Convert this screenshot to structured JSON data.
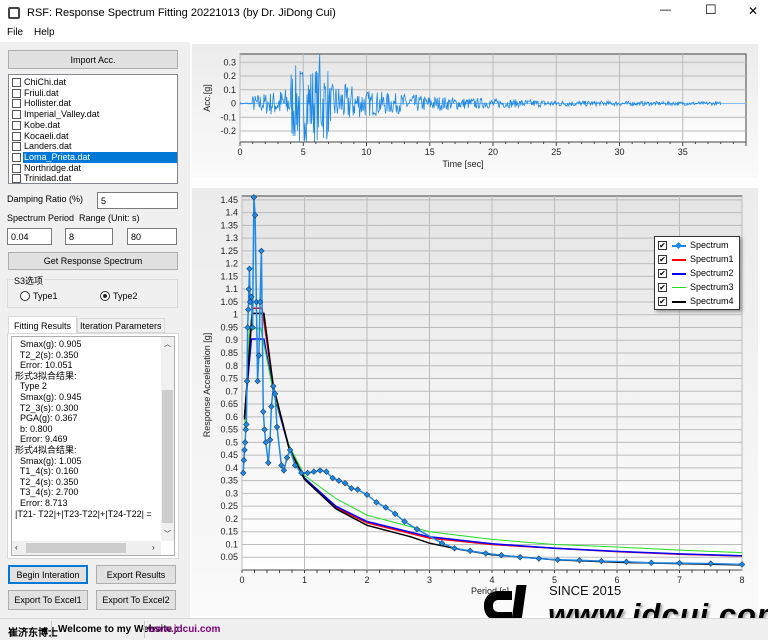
{
  "window": {
    "title": "RSF: Response Spectrum Fitting 20221013 (by Dr. JiDong Cui)",
    "minimize": "—",
    "maximize": "☐",
    "close": "✕"
  },
  "menu": [
    "File",
    "Help"
  ],
  "left": {
    "import_button": "Import Acc.",
    "files": [
      {
        "name": "ChiChi.dat",
        "selected": false
      },
      {
        "name": "Friuli.dat",
        "selected": false
      },
      {
        "name": "Hollister.dat",
        "selected": false
      },
      {
        "name": "Imperial_Valley.dat",
        "selected": false
      },
      {
        "name": "Kobe.dat",
        "selected": false
      },
      {
        "name": "Kocaeli.dat",
        "selected": false
      },
      {
        "name": "Landers.dat",
        "selected": false
      },
      {
        "name": "Loma_Prieta.dat",
        "selected": true
      },
      {
        "name": "Northridge.dat",
        "selected": false
      },
      {
        "name": "Trinidad.dat",
        "selected": false
      }
    ],
    "damping_label": "Damping Ratio (%)",
    "damping_value": "5",
    "period_label": "Spectrum Period  Range (Unit: s)",
    "period_min": "0.04",
    "period_max": "8",
    "period_count": "80",
    "get_spectrum_button": "Get Response Spectrum",
    "s3_group": "S3选项",
    "type1": "Type1",
    "type2": "Type2",
    "selected_type": "Type2",
    "tabs": [
      "Fitting Results",
      "Iteration Parameters"
    ],
    "results_lines": [
      "  Smax(g): 0.905",
      "  T2_2(s): 0.350",
      "  Error: 10.051",
      "形式3拟合结果:",
      "  Type 2",
      "  Smax(g): 0.945",
      "  T2_3(s): 0.300",
      "  PGA(g): 0.367",
      "  b: 0.800",
      "  Error: 9.469",
      "形式4拟合结果:",
      "  Smax(g): 1.005",
      "  T1_4(s): 0.160",
      "  T2_4(s): 0.350",
      "  T3_4(s): 2.700",
      "  Error: 8.713",
      "|T21- T22|+|T23-T22|+|T24-T22| ="
    ],
    "buttons": {
      "begin": "Begin Interation",
      "export_results": "Export Results",
      "excel1": "Export To Excel1",
      "excel2": "Export To Excel2"
    }
  },
  "status": {
    "name": "崔济东博士",
    "welcome": "Welcome to my Website :",
    "url": "www.jdcui.com"
  },
  "watermark": {
    "since": "SINCE 2015",
    "site": "www.jdcui.com"
  },
  "colors": {
    "spectrum": "#1e88e5",
    "s1": "#ff0000",
    "s2": "#0000ff",
    "s3": "#00e000",
    "s4": "#000000",
    "url": "#800080",
    "select": "#0078d7"
  },
  "chart_data": [
    {
      "type": "line",
      "title": "",
      "xlabel": "Time [sec]",
      "ylabel": "Acc.[g]",
      "xlim": [
        0,
        40
      ],
      "ylim": [
        -0.28,
        0.36
      ],
      "xticks": [
        "0",
        "5",
        "10",
        "15",
        "20",
        "25",
        "30",
        "35"
      ],
      "yticks": [
        "0.3",
        "0.2",
        "0.1",
        "0",
        "-0.1",
        "-0.2"
      ],
      "record": {
        "duration_s": 38,
        "peak_positive_g": 0.36,
        "peak_positive_time_s": 6.3,
        "peak_negative_g": -0.28,
        "peak_negative_time_s": 4.7
      }
    },
    {
      "type": "line",
      "xlabel": "Period [s]",
      "ylabel": "Response Acceleration [g]",
      "xlim": [
        0,
        8
      ],
      "ylim": [
        0,
        1.465
      ],
      "grid": true,
      "legend": "top-right",
      "xticks": [
        "0",
        "1",
        "2",
        "3",
        "4",
        "5",
        "6",
        "7",
        "8"
      ],
      "yticks": [
        "1.45",
        "1.4",
        "1.35",
        "1.3",
        "1.25",
        "1.2",
        "1.15",
        "1.1",
        "1.05",
        "1",
        "0.95",
        "0.9",
        "0.85",
        "0.8",
        "0.75",
        "0.7",
        "0.65",
        "0.6",
        "0.55",
        "0.5",
        "0.45",
        "0.4",
        "0.35",
        "0.3",
        "0.25",
        "0.2",
        "0.15",
        "0.1",
        "0.05"
      ],
      "series": [
        {
          "name": "Spectrum",
          "color": "#1e88e5",
          "markers": true,
          "points": [
            [
              0.02,
              0.38
            ],
            [
              0.03,
              0.43
            ],
            [
              0.04,
              0.47
            ],
            [
              0.05,
              0.5
            ],
            [
              0.06,
              0.55
            ],
            [
              0.07,
              0.57
            ],
            [
              0.08,
              0.74
            ],
            [
              0.09,
              0.95
            ],
            [
              0.1,
              1.02
            ],
            [
              0.11,
              1.1
            ],
            [
              0.12,
              1.18
            ],
            [
              0.13,
              1.05
            ],
            [
              0.15,
              1.07
            ],
            [
              0.17,
              0.95
            ],
            [
              0.19,
              1.46
            ],
            [
              0.21,
              1.39
            ],
            [
              0.23,
              1.05
            ],
            [
              0.25,
              0.74
            ],
            [
              0.27,
              0.84
            ],
            [
              0.29,
              1.05
            ],
            [
              0.31,
              1.25
            ],
            [
              0.34,
              0.62
            ],
            [
              0.36,
              0.55
            ],
            [
              0.38,
              0.5
            ],
            [
              0.42,
              0.42
            ],
            [
              0.45,
              0.51
            ],
            [
              0.47,
              0.64
            ],
            [
              0.5,
              0.72
            ],
            [
              0.53,
              0.69
            ],
            [
              0.56,
              0.56
            ],
            [
              0.63,
              0.41
            ],
            [
              0.67,
              0.39
            ],
            [
              0.72,
              0.44
            ],
            [
              0.77,
              0.47
            ],
            [
              0.85,
              0.41
            ],
            [
              0.95,
              0.38
            ],
            [
              1.05,
              0.38
            ],
            [
              1.15,
              0.385
            ],
            [
              1.25,
              0.39
            ],
            [
              1.35,
              0.385
            ],
            [
              1.45,
              0.36
            ],
            [
              1.55,
              0.35
            ],
            [
              1.65,
              0.34
            ],
            [
              1.75,
              0.32
            ],
            [
              1.85,
              0.315
            ],
            [
              2.0,
              0.295
            ],
            [
              2.15,
              0.265
            ],
            [
              2.3,
              0.245
            ],
            [
              2.45,
              0.22
            ],
            [
              2.6,
              0.19
            ],
            [
              2.8,
              0.16
            ],
            [
              3.2,
              0.105
            ],
            [
              3.4,
              0.085
            ],
            [
              3.65,
              0.075
            ],
            [
              3.9,
              0.065
            ],
            [
              4.15,
              0.058
            ],
            [
              4.45,
              0.05
            ],
            [
              4.75,
              0.045
            ],
            [
              5.05,
              0.04
            ],
            [
              5.4,
              0.038
            ],
            [
              5.75,
              0.035
            ],
            [
              6.15,
              0.032
            ],
            [
              6.55,
              0.028
            ],
            [
              7.0,
              0.027
            ],
            [
              7.5,
              0.025
            ],
            [
              8.0,
              0.022
            ]
          ]
        },
        {
          "name": "Spectrum1",
          "color": "#ff0000",
          "points": [
            [
              0.04,
              0.6
            ],
            [
              0.17,
              1.025
            ],
            [
              0.32,
              1.025
            ],
            [
              0.5,
              0.72
            ],
            [
              0.75,
              0.48
            ],
            [
              1,
              0.36
            ],
            [
              1.5,
              0.245
            ],
            [
              2,
              0.185
            ],
            [
              3,
              0.125
            ],
            [
              4,
              0.1
            ],
            [
              5,
              0.085
            ],
            [
              6,
              0.072
            ],
            [
              7,
              0.062
            ],
            [
              8,
              0.055
            ]
          ]
        },
        {
          "name": "Spectrum2",
          "color": "#0000ff",
          "points": [
            [
              0.04,
              0.6
            ],
            [
              0.15,
              0.905
            ],
            [
              0.35,
              0.905
            ],
            [
              0.5,
              0.7
            ],
            [
              0.75,
              0.48
            ],
            [
              1,
              0.36
            ],
            [
              1.5,
              0.25
            ],
            [
              2,
              0.19
            ],
            [
              3,
              0.13
            ],
            [
              4,
              0.103
            ],
            [
              5,
              0.085
            ],
            [
              6,
              0.073
            ],
            [
              7,
              0.063
            ],
            [
              8,
              0.056
            ]
          ]
        },
        {
          "name": "Spectrum3",
          "color": "#22dd22",
          "points": [
            [
              0.04,
              0.55
            ],
            [
              0.12,
              0.945
            ],
            [
              0.3,
              0.945
            ],
            [
              0.5,
              0.7
            ],
            [
              0.75,
              0.49
            ],
            [
              1,
              0.37
            ],
            [
              1.5,
              0.28
            ],
            [
              2,
              0.215
            ],
            [
              3,
              0.15
            ],
            [
              4,
              0.12
            ],
            [
              5,
              0.1
            ],
            [
              6,
              0.09
            ],
            [
              7,
              0.078
            ],
            [
              8,
              0.068
            ]
          ]
        },
        {
          "name": "Spectrum4",
          "color": "#000000",
          "points": [
            [
              0.04,
              0.59
            ],
            [
              0.16,
              1.005
            ],
            [
              0.35,
              1.005
            ],
            [
              0.5,
              0.72
            ],
            [
              0.75,
              0.48
            ],
            [
              1,
              0.355
            ],
            [
              1.5,
              0.24
            ],
            [
              2,
              0.175
            ],
            [
              2.7,
              0.13
            ],
            [
              3,
              0.105
            ],
            [
              3.5,
              0.08
            ],
            [
              4,
              0.06
            ],
            [
              5,
              0.04
            ],
            [
              6,
              0.03
            ],
            [
              7,
              0.025
            ],
            [
              8,
              0.02
            ]
          ]
        }
      ]
    }
  ]
}
